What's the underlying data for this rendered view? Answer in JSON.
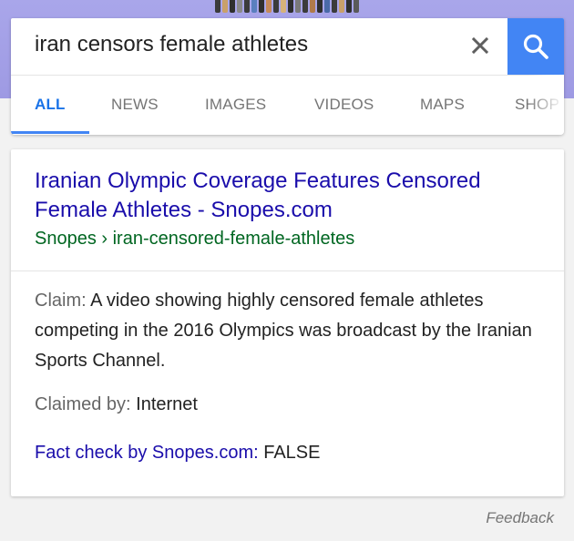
{
  "search": {
    "query": "iran censors female athletes"
  },
  "tabs": [
    {
      "label": "ALL",
      "active": true
    },
    {
      "label": "NEWS",
      "active": false
    },
    {
      "label": "IMAGES",
      "active": false
    },
    {
      "label": "VIDEOS",
      "active": false
    },
    {
      "label": "MAPS",
      "active": false
    },
    {
      "label": "SHOP",
      "active": false
    }
  ],
  "result": {
    "title": "Iranian Olympic Coverage Features Censored Female Athletes - Snopes.com",
    "url": "Snopes › iran-censored-female-athletes",
    "claim_label": "Claim:",
    "claim_text": " A video showing highly censored female athletes competing in the 2016 Olympics was broadcast by the Iranian Sports Channel.",
    "claimed_by_label": "Claimed by:",
    "claimed_by_value": " Internet",
    "fact_check_label": "Fact check by Snopes.com:",
    "fact_check_value": " FALSE"
  },
  "footer": {
    "feedback": "Feedback"
  },
  "colors": {
    "accent": "#4285f4",
    "link": "#1a0dab",
    "url": "#006621",
    "header_band": "#a9a6ea"
  },
  "icons": {
    "clear": "close-icon",
    "search": "search-icon"
  }
}
